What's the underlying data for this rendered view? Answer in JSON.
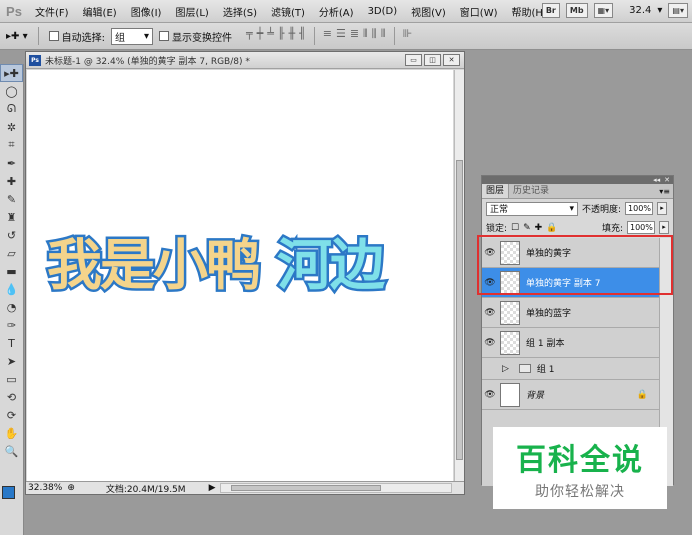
{
  "app": {
    "logo": "Ps",
    "menu": [
      "文件(F)",
      "编辑(E)",
      "图像(I)",
      "图层(L)",
      "选择(S)",
      "滤镜(T)",
      "分析(A)",
      "3D(D)",
      "视图(V)",
      "窗口(W)",
      "帮助(H)"
    ],
    "right_buttons": [
      "Br",
      "Mb"
    ],
    "zoom": "32.4"
  },
  "options": {
    "auto_select_label": "自动选择:",
    "auto_select_value": "组",
    "transform_label": "显示变换控件"
  },
  "document": {
    "title": "未标题-1 @ 32.4% (单独的黄字 副本 7, RGB/8) *",
    "badge": "Ps",
    "canvas_text_yellow": "我是小鸭",
    "canvas_text_cyan": "河边",
    "status_zoom": "32.38%",
    "status_doc": "文档:20.4M/19.5M"
  },
  "layers_panel": {
    "tabs": [
      "图层",
      "历史记录"
    ],
    "blend_mode": "正常",
    "opacity_label": "不透明度:",
    "opacity_value": "100%",
    "lock_label": "锁定:",
    "fill_label": "填充:",
    "fill_value": "100%",
    "layers": [
      {
        "name": "单独的黄字",
        "visible": true,
        "selected": false
      },
      {
        "name": "单独的黄字 副本 7",
        "visible": true,
        "selected": true
      },
      {
        "name": "单独的蓝字",
        "visible": true,
        "selected": false
      },
      {
        "name": "组 1 副本",
        "visible": true,
        "selected": false
      },
      {
        "name": "组 1",
        "visible": false,
        "selected": false,
        "group": true
      },
      {
        "name": "背景",
        "visible": true,
        "selected": false,
        "locked": true
      }
    ]
  },
  "watermark": {
    "title": "百科全说",
    "subtitle": "助你轻松解决"
  }
}
